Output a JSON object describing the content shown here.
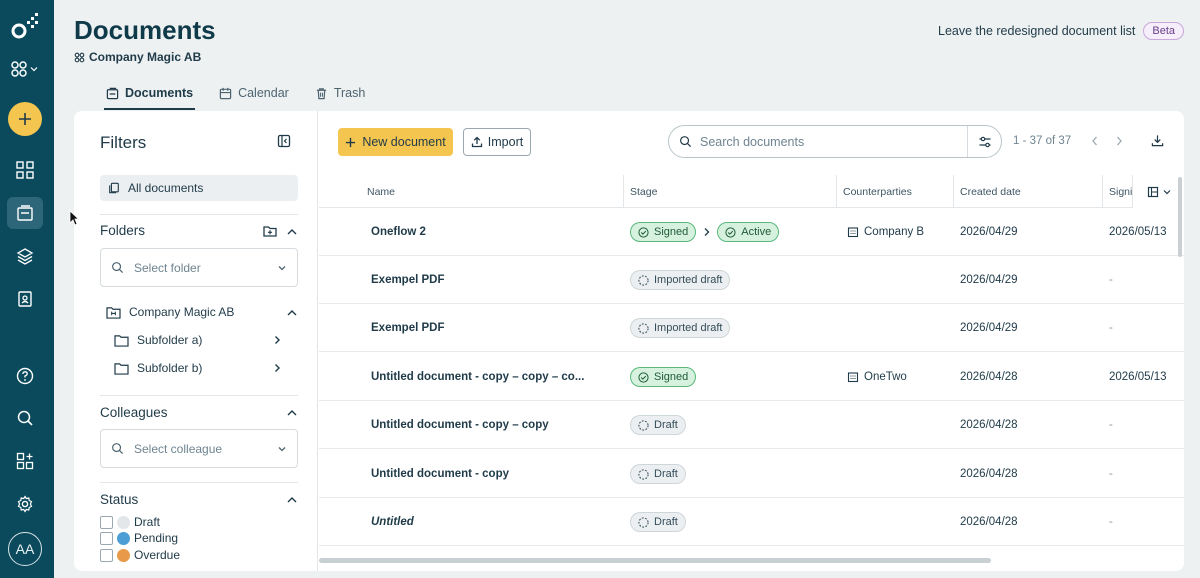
{
  "header": {
    "title": "Documents",
    "company": "Company Magic AB",
    "leave_redesign": "Leave the redesigned document list",
    "beta_badge": "Beta"
  },
  "tabs": [
    {
      "label": "Documents",
      "icon": "document-icon",
      "active": true
    },
    {
      "label": "Calendar",
      "icon": "calendar-icon",
      "active": false
    },
    {
      "label": "Trash",
      "icon": "trash-icon",
      "active": false
    }
  ],
  "rail": {
    "avatar_initials": "AA",
    "items": [
      "logo-icon",
      "workspace-icon",
      "add-icon",
      "dashboard-icon",
      "documents-icon",
      "templates-icon",
      "address-book-icon",
      "help-icon",
      "search-icon",
      "marketplace-icon",
      "settings-icon"
    ]
  },
  "filters": {
    "title": "Filters",
    "all_documents": "All documents",
    "folders": {
      "label": "Folders",
      "placeholder": "Select folder",
      "root": "Company Magic AB",
      "children": [
        "Subfolder a)",
        "Subfolder b)"
      ]
    },
    "colleagues": {
      "label": "Colleagues",
      "placeholder": "Select colleague"
    },
    "status": {
      "label": "Status",
      "items": [
        {
          "label": "Draft",
          "color": "#e3e6e8"
        },
        {
          "label": "Pending",
          "color": "#4b9fd5"
        },
        {
          "label": "Overdue",
          "color": "#e89a4a"
        }
      ]
    }
  },
  "toolbar": {
    "new_document": "New document",
    "import": "Import",
    "search_placeholder": "Search documents",
    "pager": "1 - 37 of 37"
  },
  "table": {
    "columns": [
      "Name",
      "Stage",
      "Counterparties",
      "Created date",
      "Signi"
    ],
    "rows": [
      {
        "name": "Oneflow 2",
        "stages": [
          "Signed",
          "Active"
        ],
        "counterparty": "Company B",
        "created": "2026/04/29",
        "signed": "2026/05/13"
      },
      {
        "name": "Exempel PDF",
        "stages": [
          "Imported draft"
        ],
        "counterparty": "",
        "created": "2026/04/29",
        "signed": "-"
      },
      {
        "name": "Exempel PDF",
        "stages": [
          "Imported draft"
        ],
        "counterparty": "",
        "created": "2026/04/29",
        "signed": "-"
      },
      {
        "name": "Untitled document - copy – copy – co...",
        "stages": [
          "Signed"
        ],
        "counterparty": "OneTwo",
        "created": "2026/04/28",
        "signed": "2026/05/13"
      },
      {
        "name": "Untitled document - copy – copy",
        "stages": [
          "Draft"
        ],
        "counterparty": "",
        "created": "2026/04/28",
        "signed": "-"
      },
      {
        "name": "Untitled document - copy",
        "stages": [
          "Draft"
        ],
        "counterparty": "",
        "created": "2026/04/28",
        "signed": "-"
      },
      {
        "name": "Untitled",
        "stages": [
          "Draft"
        ],
        "counterparty": "",
        "created": "2026/04/28",
        "signed": "-",
        "italic": true
      }
    ]
  },
  "colors": {
    "rail": "#0b4a5c",
    "accent": "#f5c64f",
    "signed": "#d6f2df"
  }
}
